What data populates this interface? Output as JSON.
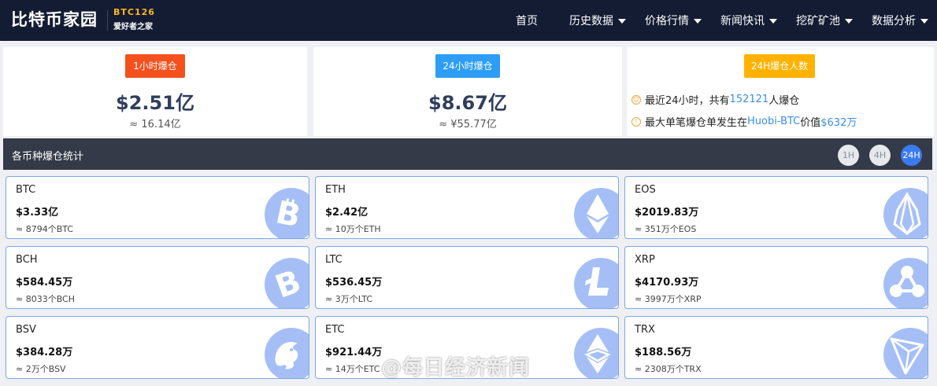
{
  "header": {
    "logo": "比特币家园",
    "logo_tag": "BTC126",
    "logo_slogan": "爱好者之家",
    "nav": [
      {
        "label": "首页",
        "dropdown": false
      },
      {
        "label": "历史数据",
        "dropdown": true
      },
      {
        "label": "价格行情",
        "dropdown": true
      },
      {
        "label": "新闻快讯",
        "dropdown": true
      },
      {
        "label": "挖矿矿池",
        "dropdown": true
      },
      {
        "label": "数据分析",
        "dropdown": true
      }
    ]
  },
  "stats": {
    "h1": {
      "label": "1小时爆仓",
      "value": "$2.51亿",
      "sub": "≈ 16.14亿",
      "color": "#f4511e"
    },
    "h24": {
      "label": "24小时爆仓",
      "value": "$8.67亿",
      "sub": "≈ ¥55.77亿",
      "color": "#2d9df5"
    },
    "people": {
      "label": "24H爆仓人数",
      "color": "#ffb300",
      "line1_pre": "最近24小时，共有",
      "line1_count": "152121",
      "line1_post": "人爆仓",
      "line2_pre": "最大单笔爆仓单发生在",
      "line2_exchange": "Huobi-BTC",
      "line2_mid": "价值",
      "line2_amount": "$632万"
    }
  },
  "section": {
    "title": "各币种爆仓统计",
    "timeframes": [
      "1H",
      "4H",
      "24H"
    ],
    "active_timeframe": "24H"
  },
  "coins": [
    {
      "name": "BTC",
      "value": "$3.33亿",
      "sub": "≈ 8794个BTC",
      "icon": "bitcoin-icon"
    },
    {
      "name": "ETH",
      "value": "$2.42亿",
      "sub": "≈ 10万个ETH",
      "icon": "ethereum-icon"
    },
    {
      "name": "EOS",
      "value": "$2019.83万",
      "sub": "≈ 351万个EOS",
      "icon": "eos-icon"
    },
    {
      "name": "BCH",
      "value": "$584.45万",
      "sub": "≈ 8033个BCH",
      "icon": "bitcoin-cash-icon"
    },
    {
      "name": "LTC",
      "value": "$536.45万",
      "sub": "≈ 3万个LTC",
      "icon": "litecoin-icon"
    },
    {
      "name": "XRP",
      "value": "$4170.93万",
      "sub": "≈ 3997万个XRP",
      "icon": "ripple-icon"
    },
    {
      "name": "BSV",
      "value": "$384.28万",
      "sub": "≈ 2万个BSV",
      "icon": "bsv-dragon-icon"
    },
    {
      "name": "ETC",
      "value": "$921.44万",
      "sub": "≈ 14万个ETC",
      "icon": "ethereum-classic-icon"
    },
    {
      "name": "TRX",
      "value": "$188.56万",
      "sub": "≈ 2308万个TRX",
      "icon": "tron-icon"
    }
  ],
  "watermark": "@每日经济新闻"
}
